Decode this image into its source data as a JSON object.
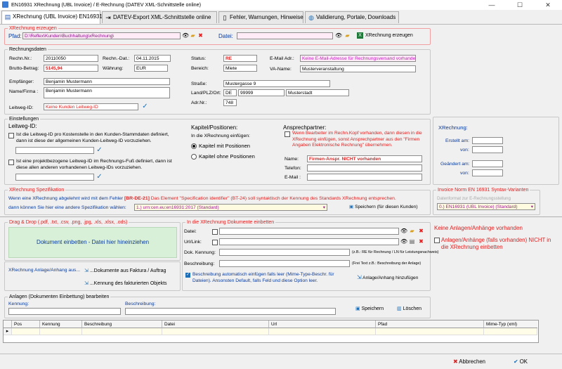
{
  "window": {
    "title": "EN16931 XRechnung (UBL Invoice) / E-Rechnung (DATEV XML-Schnittstelle online)",
    "min": "—",
    "max": "☐",
    "close": "✕"
  },
  "tabs": [
    {
      "label": "XRechnung (UBL Invoice) EN16931",
      "icon": "invoice-icon"
    },
    {
      "label": "DATEV-Export XML-Schnittstelle online",
      "icon": "export-icon"
    },
    {
      "label": "Fehler, Warnungen, Hinweise",
      "icon": "document-icon"
    },
    {
      "label": "Validierung, Portale, Downloads",
      "icon": "globe-icon"
    }
  ],
  "erzeugen": {
    "legend": "XRechnung erzeugen",
    "pfad_label": "Pfad:",
    "pfad_value": "D:\\Reflex\\Kunden\\Buchhaltung\\xRechnung\\",
    "datei_label": "Datei:",
    "datei_value": "",
    "btn": "XRechnung erzeugen"
  },
  "rechnungsdaten": {
    "legend": "Rechnungsdaten",
    "rechnr_label": "Rechn.Nr.:",
    "rechnr": "20110050",
    "rechndat_label": "Rechn.-Dat.:",
    "rechndat": "04.11.2015",
    "brutto_label": "Brutto-Betrag:",
    "brutto": "5145,94",
    "waehrung_label": "Währung:",
    "waehrung": "EUR",
    "status_label": "Status:",
    "status": "RE",
    "bereich_label": "Bereich:",
    "bereich": "Miete",
    "email_label": "E-Mail Adr.:",
    "email": "Keine E-Mail-Adresse für Rechnungsversand vorhanden",
    "vaname_label": "VA-Name:",
    "vaname": "Musterveranstaltung",
    "empf_label": "Empfänger:",
    "empf": "Benjamin Mustermann",
    "name_label": "Name/Firma :",
    "name": "Benjamin Mustermann",
    "leitweg_label": "Leitweg-ID:",
    "leitweg": "Keine Kunden Leitweg-ID",
    "strasse_label": "Straße:",
    "strasse": "Mustergasse 9",
    "land_label": "Land/PLZ/Ort:",
    "land": "DE",
    "plz": "99999",
    "ort": "Musterstadt",
    "adrnr_label": "Adr.Nr.:",
    "adrnr": "748"
  },
  "einstellungen": {
    "legend": "Einstellungen",
    "leitweg_title": "Leitweg-ID:",
    "cb1": "Ist die Leitweg-ID pro Kostenstelle in den Kunden-Stammdaten definiert, dann ist diese der allgemeinen Kunden-Leitweg-ID vorzuziehen.",
    "cb2": "Ist eine projektbezogene Leitweg-ID im Rechnungs-Fuß definiert, dann ist diese allen anderen vorhandenen Leitweg-IDs vorzuziehen.",
    "kapitel_title": "Kapitel/Positionen:",
    "kapitel_sub": "In die XRechnung einfügen:",
    "rb1": "Kapitel mit Positionen",
    "rb2": "Kapitel ohne Positionen",
    "ansp_title": "Ansprechpartner:",
    "ansp_cb": "Wenn Bearbeiter im Rechn.Kopf vorhanden, dann diesen in die XRechnung einfügen, sonst Ansprechpartner aus den \"Firmen Angaben Elektronische Rechnung\" übernehmen.",
    "ansp_name_label": "Name:",
    "ansp_name": "Firmen-Anspr. NICHT vorhanden",
    "telefon_label": "Telefon:",
    "email_label": "E-Mail :"
  },
  "xr_box": {
    "title": "XRechnung:",
    "erstellt": "Erstellt am:",
    "von1": "von:",
    "geaendert": "Geändert am:",
    "von2": "von:"
  },
  "spez": {
    "legend": "XRechnung Spezifikation",
    "line1a": "Wenn eine XRechnung abgelehnt wird mit dem Fehler",
    "code": "[BR-DE-21]",
    "line1b": "Das Element \"Specification identifier\" (BT-24) soll syntaktisch der Kennung des Standards XRechnung entsprechen.",
    "line2": "dann können Sie hier eine andere Spezifikation wählen:",
    "select": "1.)   urn:cen.eu:en16931:2017 (Standard)",
    "save": "Speichern (für diesen Kunden)"
  },
  "norm": {
    "legend": "Invoice Norm EN 16931 Syntax-Varianten",
    "sub": "Datenformat zur E-Rechnungsstellung",
    "select": "0.)  EN16931 (UBL Invoice)  (Standard)"
  },
  "dragdrop": {
    "legend": "Drag & Drop (.pdf, .txt, .csv, .png, .jpg, .xls, .xlsx, .ods)",
    "zone": "Dokument einbetten - Datei hier hineinziehen",
    "anlage_label": "XRechnung Anlage/Anhang aus...",
    "btn1": "...Dokumente aus Faktura / Auftrag",
    "btn2": "...Kennung des fakturierten Objekts"
  },
  "einbetten": {
    "legend": "In die XRechnung Dokumente einbetten",
    "datei": "Datei:",
    "url": "Url/Link:",
    "kennung": "Dok. Kennung:",
    "kennung_hint": "(z.B.: RE für Rechnung / LN für Leistungsnachweis)",
    "beschr": "Beschreibung:",
    "beschr_hint": "(Frei Text z.B.: Beschreibung der Anlage)",
    "auto_cb": "Beschreibung automatisch einfügen falls leer (Mime-Type-Beschr. für Dateien). Ansonsten Default, falls Feld und diese Option leer.",
    "add_btn": "Anlage/Anhang hinzufügen"
  },
  "rightinfo": {
    "keine": "Keine Anlagen/Anhänge vorhanden",
    "cb": "Anlagen/Anhänge (falls vorhanden) NICHT in die XRechnung einbetten"
  },
  "anlagen": {
    "legend": "Anlagen (Dokumenten Einbettung)   bearbeiten",
    "kennung": "Kennung:",
    "beschr": "Beschreibung:",
    "save": "Speichern",
    "delete": "Löschen"
  },
  "grid": {
    "columns": [
      "Pos",
      "Kennung",
      "Beschreibung",
      "Datei",
      "Url",
      "Pfad",
      "Mime-Typ (xml)"
    ]
  },
  "footer": {
    "cancel": "Abbrechen",
    "ok": "OK"
  },
  "colors": {
    "accent_red": "#e02020",
    "label_blue": "#0a3a9a",
    "drop_green": "#d8f0d8",
    "pink_field": "#ffecf6",
    "yellow_field": "#fffbe0"
  }
}
